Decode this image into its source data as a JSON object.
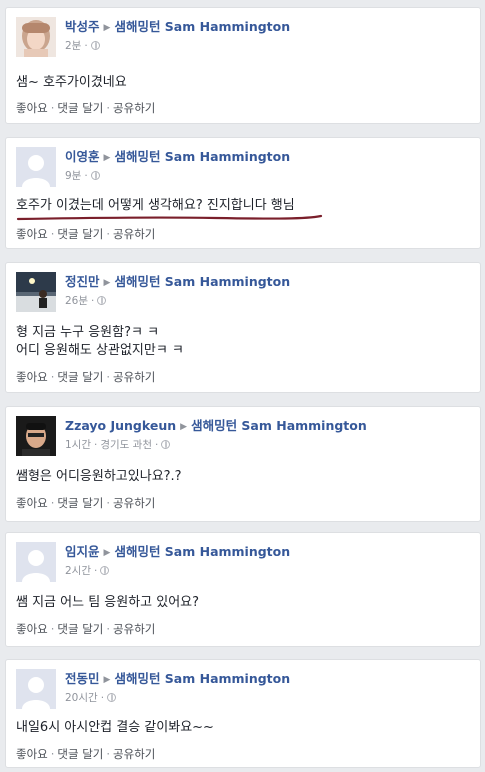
{
  "target_name": "샘해밍턴 Sam Hammington",
  "actions": {
    "like": "좋아요",
    "comment": "댓글 달기",
    "share": "공유하기",
    "separator": "·"
  },
  "posts": [
    {
      "author": "박성주",
      "time": "2분",
      "location": "",
      "text_lines": [
        "샘~ 호주가이겼네요"
      ]
    },
    {
      "author": "이영훈",
      "time": "9분",
      "location": "",
      "text_lines": [
        "호주가 이겼는데 어떻게 생각해요? 진지합니다 행님"
      ]
    },
    {
      "author": "정진만",
      "time": "26분",
      "location": "",
      "text_lines": [
        "형 지금 누구 응원함?ㅋ ㅋ",
        "어디 응원해도 상관없지만ㅋ ㅋ"
      ]
    },
    {
      "author": "Zzayo Jungkeun",
      "time": "1시간",
      "location": "경기도 과천",
      "text_lines": [
        "쌤형은 어디응원하고있나요?.?"
      ]
    },
    {
      "author": "임지윤",
      "time": "2시간",
      "location": "",
      "text_lines": [
        "쌤 지금 어느 팀 응원하고 있어요?"
      ]
    },
    {
      "author": "전동민",
      "time": "20시간",
      "location": "",
      "text_lines": [
        "내일6시 아시안컵 결승 같이봐요~~"
      ]
    }
  ],
  "colors": {
    "link": "#365899",
    "underline_mark": "#7a1f2b",
    "background": "#e9ebee"
  }
}
